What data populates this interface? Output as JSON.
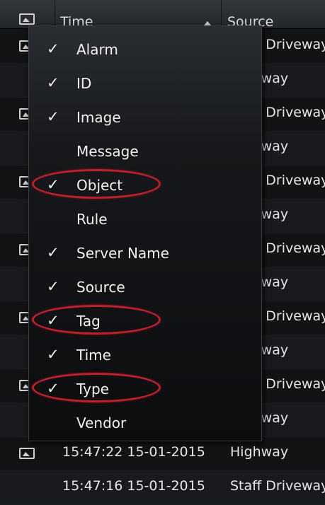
{
  "header": {
    "time_label": "Time",
    "source_label": "Source",
    "icon": "image-icon",
    "sort_icon": "sort-ascending-icon"
  },
  "rows": [
    {
      "time": "",
      "source": "Staff Driveway"
    },
    {
      "time": "",
      "source": "Highway"
    },
    {
      "time": "",
      "source": "Staff Driveway"
    },
    {
      "time": "",
      "source": "Highway"
    },
    {
      "time": "",
      "source": "Staff Driveway"
    },
    {
      "time": "",
      "source": "Highway"
    },
    {
      "time": "",
      "source": "Staff Driveway"
    },
    {
      "time": "",
      "source": "Highway"
    },
    {
      "time": "",
      "source": "Staff Driveway"
    },
    {
      "time": "",
      "source": "Highway"
    },
    {
      "time": "",
      "source": "Staff Driveway"
    },
    {
      "time": "",
      "source": "Highway"
    },
    {
      "time": "15:47:22 15-01-2015",
      "source": "Highway"
    },
    {
      "time": "15:47:16 15-01-2015",
      "source": "Staff Driveway"
    }
  ],
  "menu": {
    "items": [
      {
        "label": "Alarm",
        "checked": true,
        "highlighted": false
      },
      {
        "label": "ID",
        "checked": true,
        "highlighted": false
      },
      {
        "label": "Image",
        "checked": true,
        "highlighted": false
      },
      {
        "label": "Message",
        "checked": false,
        "highlighted": false
      },
      {
        "label": "Object",
        "checked": true,
        "highlighted": true
      },
      {
        "label": "Rule",
        "checked": false,
        "highlighted": false
      },
      {
        "label": "Server Name",
        "checked": true,
        "highlighted": false
      },
      {
        "label": "Source",
        "checked": true,
        "highlighted": false
      },
      {
        "label": "Tag",
        "checked": true,
        "highlighted": true
      },
      {
        "label": "Time",
        "checked": true,
        "highlighted": false
      },
      {
        "label": "Type",
        "checked": true,
        "highlighted": true
      },
      {
        "label": "Vendor",
        "checked": false,
        "highlighted": false
      }
    ],
    "check_glyph": "✓",
    "highlight_color": "#c01f2a"
  }
}
